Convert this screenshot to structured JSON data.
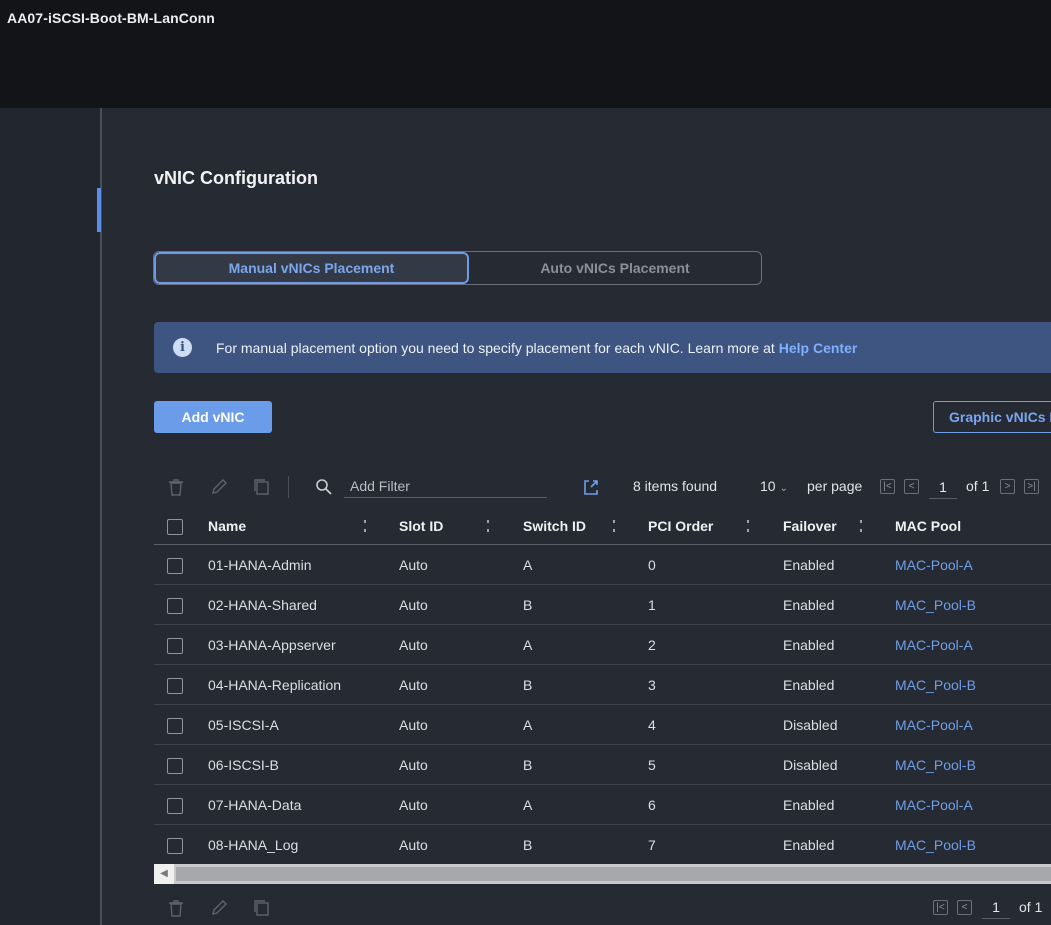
{
  "window": {
    "title": "AA07-iSCSI-Boot-BM-LanConn"
  },
  "section": {
    "title": "vNIC Configuration"
  },
  "placement_toggle": {
    "options": [
      {
        "label": "Manual vNICs Placement",
        "selected": true
      },
      {
        "label": "Auto vNICs Placement",
        "selected": false
      }
    ]
  },
  "info_banner": {
    "text": "For manual placement option you need to specify placement for each vNIC. Learn more at",
    "link": "Help Center"
  },
  "actions": {
    "add_label": "Add vNIC",
    "graphic_label": "Graphic vNICs Editor"
  },
  "toolbar": {
    "filter_placeholder": "Add Filter",
    "items_found": "8 items found",
    "per_page_value": "10",
    "per_page_label": "per page",
    "page": "1",
    "of_pages": "of 1"
  },
  "table": {
    "columns": [
      "Name",
      "Slot ID",
      "Switch ID",
      "PCI Order",
      "Failover",
      "MAC Pool"
    ],
    "rows": [
      [
        "01-HANA-Admin",
        "Auto",
        "A",
        "0",
        "Enabled",
        "MAC-Pool-A"
      ],
      [
        "02-HANA-Shared",
        "Auto",
        "B",
        "1",
        "Enabled",
        "MAC_Pool-B"
      ],
      [
        "03-HANA-Appserver",
        "Auto",
        "A",
        "2",
        "Enabled",
        "MAC-Pool-A"
      ],
      [
        "04-HANA-Replication",
        "Auto",
        "B",
        "3",
        "Enabled",
        "MAC_Pool-B"
      ],
      [
        "05-ISCSI-A",
        "Auto",
        "A",
        "4",
        "Disabled",
        "MAC-Pool-A"
      ],
      [
        "06-ISCSI-B",
        "Auto",
        "B",
        "5",
        "Disabled",
        "MAC_Pool-B"
      ],
      [
        "07-HANA-Data",
        "Auto",
        "A",
        "6",
        "Enabled",
        "MAC-Pool-A"
      ],
      [
        "08-HANA_Log",
        "Auto",
        "B",
        "7",
        "Enabled",
        "MAC_Pool-B"
      ]
    ]
  },
  "bottom_pager": {
    "page": "1",
    "of_pages": "of 1"
  },
  "colors": {
    "accent": "#6a9cea",
    "link": "#6f9fe8",
    "banner": "#3d5580",
    "background": "#262a32"
  }
}
